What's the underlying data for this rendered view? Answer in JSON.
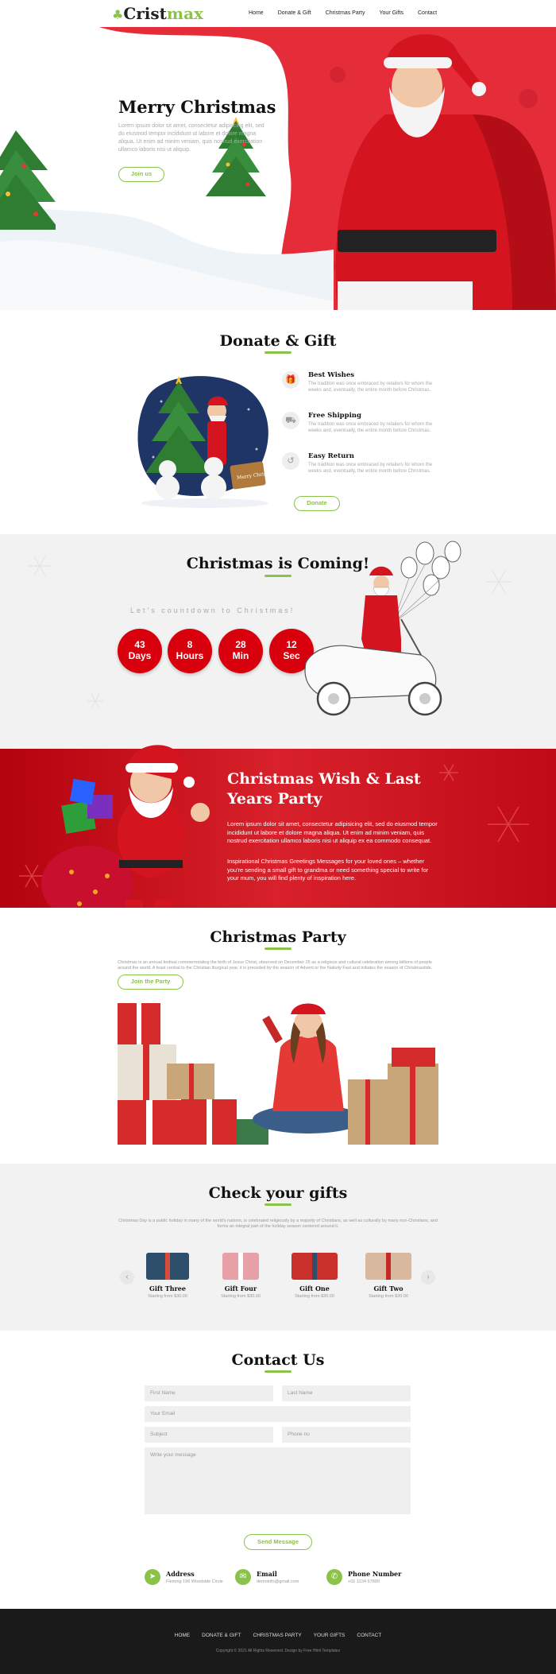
{
  "brand": {
    "logo_main": "Crist",
    "logo_accent": "max"
  },
  "nav": {
    "items": [
      "Home",
      "Donate & Gift",
      "Christmas Party",
      "Your Gifts",
      "Contact"
    ]
  },
  "hero": {
    "title": "Merry Christmas",
    "text": "Lorem ipsum dolor sit amet, consectetur adipiscing elit, sed do eiusmod tempor incididunt ut labore et dolore magna aliqua. Ut enim ad minim veniam, quis nostrud exercitation ullamco laboris nisi ut aliquip.",
    "button": "Join us"
  },
  "donate": {
    "title": "Donate & Gift",
    "features": [
      {
        "title": "Best Wishes",
        "text": "The tradition was once embraced by retailers for whom the weeks and, eventually, the entire month before Christmas."
      },
      {
        "title": "Free Shipping",
        "text": "The tradition was once embraced by retailers for whom the weeks and, eventually, the entire month before Christmas."
      },
      {
        "title": "Easy Return",
        "text": "The tradition was once embraced by retailers for whom the weeks and, eventually, the entire month before Christmas."
      }
    ],
    "button": "Donate",
    "sign_text": "Merry Christmas"
  },
  "countdown": {
    "title": "Christmas is Coming!",
    "subtitle": "Let's countdown to Christmas!",
    "items": [
      {
        "value": "43",
        "unit": "Days"
      },
      {
        "value": "8",
        "unit": "Hours"
      },
      {
        "value": "28",
        "unit": "Min"
      },
      {
        "value": "12",
        "unit": "Sec"
      }
    ]
  },
  "wish": {
    "title": "Christmas Wish & Last Years Party",
    "p1": "Lorem ipsum dolor sit amet, consectetur adipisicing elit, sed do eiusmod tempor incididunt ut labore et dolore magna aliqua. Ut enim ad minim veniam, quis nostrud exercitation ullamco laboris nisi ut aliquip ex ea commodo consequat.",
    "p2": "Inspirational Christmas Greetings Messages for your loved ones – whether you're sending a small gift to grandma or need something special to write for your mum, you will find plenty of inspiration here."
  },
  "party": {
    "title": "Christmas Party",
    "text": "Christmas is an annual festival commemorating the birth of Jesus Christ, observed on December 25 as a religious and cultural celebration among billions of people around the world. A feast central to the Christian liturgical year, it is preceded by the season of Advent or the Nativity Fast and initiates the season of Christmastide.",
    "button": "Join the Party"
  },
  "gifts": {
    "title": "Check your gifts",
    "text": "Christmas Day is a public holiday in many of the world's nations, is celebrated religiously by a majority of Christians, as well as culturally by many non-Christians, and forms an integral part of the holiday season centered around it.",
    "items": [
      {
        "name": "Gift Three",
        "price": "Starting from $30.00",
        "color": "#2d4f6c"
      },
      {
        "name": "Gift Four",
        "price": "Starting from $30.00",
        "color": "#e8a0a8"
      },
      {
        "name": "Gift One",
        "price": "Starting from $30.00",
        "color": "#c9302c"
      },
      {
        "name": "Gift Two",
        "price": "Starting from $30.00",
        "color": "#d9b8a0"
      }
    ],
    "prev_icon": "chevron-left-icon",
    "next_icon": "chevron-right-icon"
  },
  "contact": {
    "title": "Contact Us",
    "fields": {
      "first_name": "First Name",
      "last_name": "Last Name",
      "email": "Your Email",
      "subject": "Subject",
      "phone": "Phone no",
      "message": "Write your message"
    },
    "button": "Send Message",
    "info": [
      {
        "title": "Address",
        "text": "Fleming 196 Woodside Circle",
        "icon": "location-icon"
      },
      {
        "title": "Email",
        "text": "demoinfo@gmail.com",
        "icon": "mail-icon"
      },
      {
        "title": "Phone Number",
        "text": "+01 1234 67890",
        "icon": "phone-icon"
      }
    ]
  },
  "footer": {
    "nav": [
      "HOME",
      "DONATE & GIFT",
      "CHRISTMAS PARTY",
      "YOUR GIFTS",
      "CONTACT"
    ],
    "copyright": "Copyright © 2021 All Rights Reserved. Design by Free Html Templates"
  },
  "colors": {
    "accent": "#8bc34a",
    "red": "#d9000d",
    "dark": "#1a1a1a"
  }
}
